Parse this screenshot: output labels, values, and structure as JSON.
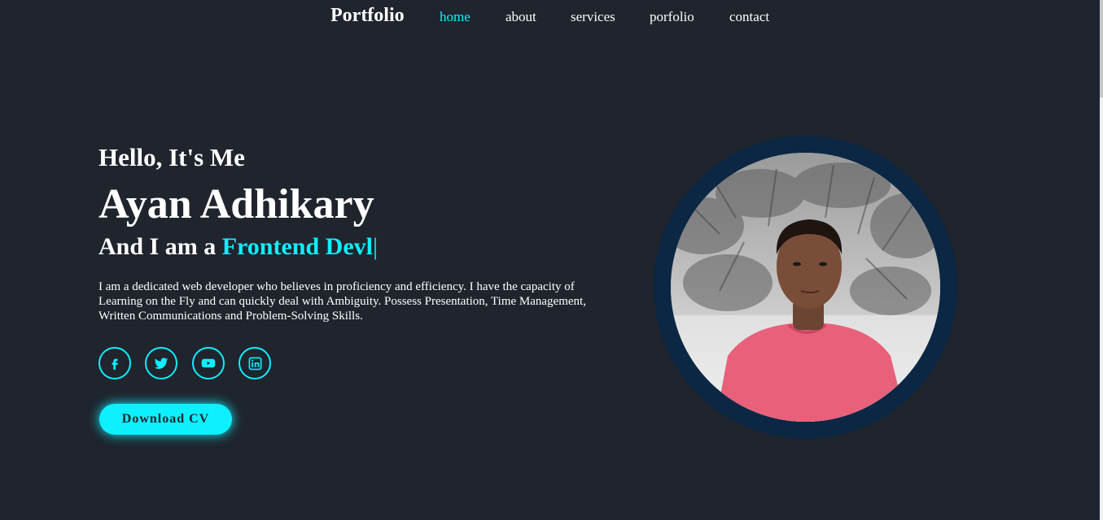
{
  "header": {
    "logo": "Portfolio",
    "nav": [
      {
        "label": "home",
        "active": true
      },
      {
        "label": "about",
        "active": false
      },
      {
        "label": "services",
        "active": false
      },
      {
        "label": "porfolio",
        "active": false
      },
      {
        "label": "contact",
        "active": false
      }
    ]
  },
  "home": {
    "greeting": "Hello, It's Me",
    "name": "Ayan Adhikary",
    "role_prefix": "And I am a ",
    "role_typed": "Frontend Devl",
    "cursor": "|",
    "description": "I am a dedicated web developer who believes in proficiency and efficiency. I have the capacity of Learning on the Fly and can quickly deal with Ambiguity. Possess Presentation, Time Management, Written Communications and Problem-Solving Skills.",
    "socials": [
      "facebook-icon",
      "twitter-icon",
      "youtube-icon",
      "linkedin-icon"
    ],
    "cv_button": "Download CV"
  },
  "colors": {
    "background": "#1f242d",
    "accent": "#0ef0ff",
    "photo_ring": "#0b2744",
    "text": "#ffffff"
  }
}
